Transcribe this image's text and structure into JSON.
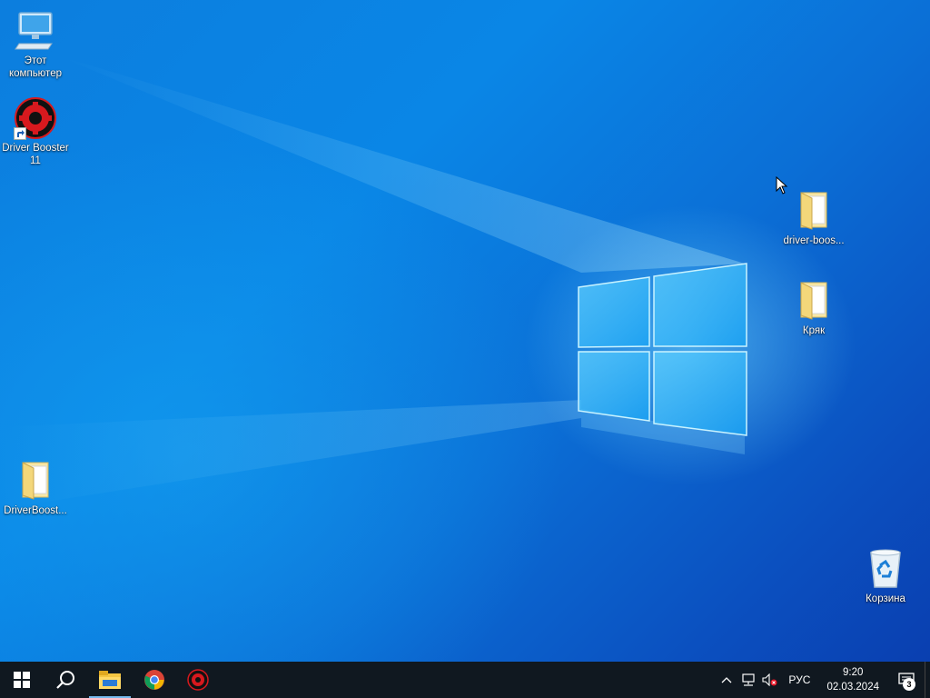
{
  "desktop": {
    "icons": [
      {
        "id": "this-pc",
        "label": "Этот компьютер"
      },
      {
        "id": "driver-booster-shortcut",
        "label": "Driver Booster 11"
      },
      {
        "id": "driver-boost-folder",
        "label": "DriverBoost..."
      },
      {
        "id": "driver-boos-folder",
        "label": "driver-boos..."
      },
      {
        "id": "kryak-folder",
        "label": "Кряк"
      },
      {
        "id": "recycle-bin",
        "label": "Корзина"
      }
    ]
  },
  "taskbar": {
    "pinned": [
      "windows-start-icon",
      "search-icon",
      "file-explorer-icon",
      "chrome-icon",
      "driver-booster-icon"
    ],
    "tray": {
      "language": "РУС",
      "time": "9:20",
      "date": "02.03.2024",
      "notifications_count": "3"
    }
  },
  "colors": {
    "taskbar": "#101820",
    "accent_underline": "#76b9ed",
    "driver_booster_red": "#d7191e"
  }
}
